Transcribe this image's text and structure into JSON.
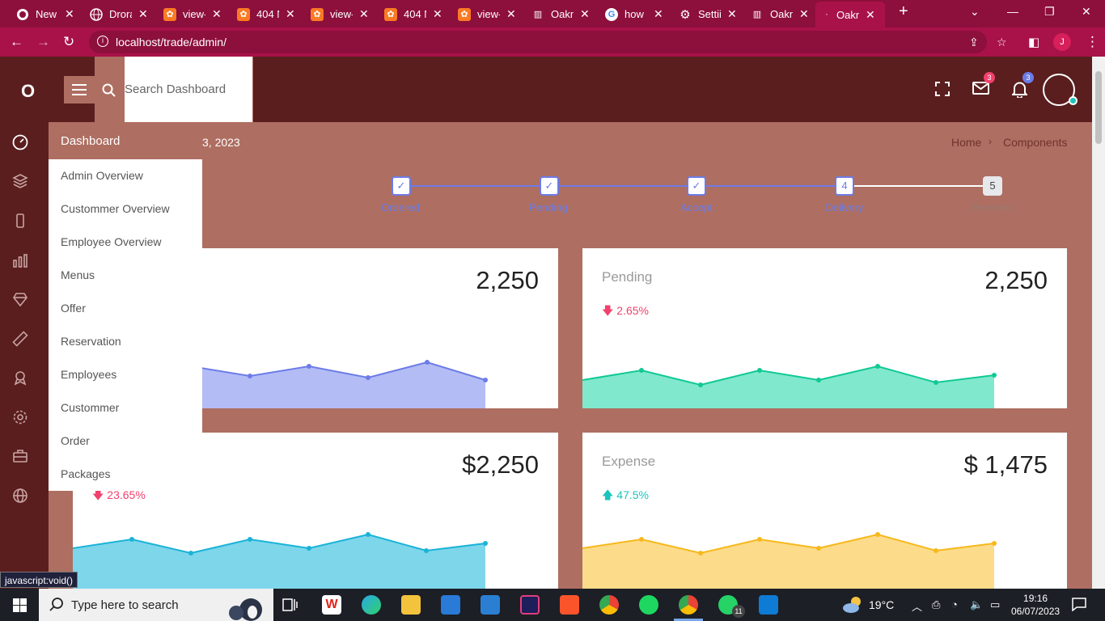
{
  "browser": {
    "tabs": [
      {
        "title": "New",
        "icon": "github-icon"
      },
      {
        "title": "Drora",
        "icon": "globe-icon"
      },
      {
        "title": "view-",
        "icon": "xampp-icon"
      },
      {
        "title": "404 N",
        "icon": "xampp-icon"
      },
      {
        "title": "view-",
        "icon": "xampp-icon"
      },
      {
        "title": "404 N",
        "icon": "xampp-icon"
      },
      {
        "title": "view-",
        "icon": "xampp-icon"
      },
      {
        "title": "Oakn",
        "icon": "barcode-icon"
      },
      {
        "title": "how",
        "icon": "google-icon"
      },
      {
        "title": "Settii",
        "icon": "gear-icon"
      },
      {
        "title": "Oakn",
        "icon": "barcode-icon"
      },
      {
        "title": "Oakn",
        "icon": "page-icon"
      }
    ],
    "url": "localhost/trade/admin/",
    "profile_initial": "J"
  },
  "header": {
    "logo": "O",
    "search_placeholder": "Search Dashboard",
    "mail_count": "3",
    "notification_count": "3"
  },
  "sidebar": {
    "icons": [
      "dashboard-icon",
      "layers-icon",
      "mobile-icon",
      "bar-chart-icon",
      "diamond-icon",
      "ruler-icon",
      "award-icon",
      "settings-icon",
      "briefcase-icon",
      "globe-icon"
    ]
  },
  "submenu": {
    "heading": "Dashboard",
    "items": [
      "Admin Overview",
      "Custommer Overview",
      "Employee Overview",
      "Menus",
      "Offer",
      "Reservation",
      "Employees",
      "Custommer",
      "Order",
      "Packages"
    ]
  },
  "page": {
    "date_fragment": "3, 2023",
    "breadcrumb": [
      "Home",
      "Components"
    ]
  },
  "steps": [
    {
      "marker": "✓",
      "label": "Ordered",
      "done": true
    },
    {
      "marker": "✓",
      "label": "Pending",
      "done": true
    },
    {
      "marker": "✓",
      "label": "Accept",
      "done": true
    },
    {
      "marker": "4",
      "label": "Delivery",
      "done": false,
      "current": true
    },
    {
      "marker": "5",
      "label": "Received",
      "done": false
    }
  ],
  "cards": [
    {
      "title": "",
      "value": "2,250",
      "change": "",
      "color": "#6c7ce7",
      "fill": "#b3bcf5"
    },
    {
      "title": "Pending",
      "value": "2,250",
      "change": "2.65%",
      "change_dir": "down",
      "color": "#10c994",
      "fill": "#80e8cd"
    },
    {
      "title": "",
      "value": "$2,250",
      "change": "23.65%",
      "change_dir": "down",
      "color": "#1ab3d8",
      "fill": "#7ed6ea"
    },
    {
      "title": "Expense",
      "value": "$ 1,475",
      "change": "47.5%",
      "change_dir": "up",
      "color": "#f6b81c",
      "fill": "#fcdc8a"
    }
  ],
  "status_tip": "javascript:void()",
  "taskbar": {
    "search_placeholder": "Type here to search",
    "weather": "19°C",
    "time": "19:16",
    "date": "06/07/2023",
    "whatsapp_badge": "11"
  },
  "colors": {
    "accent_blue": "#6c7ce7",
    "down": "#f1416c",
    "up": "#1bc5bd",
    "header": "#5a1e1e",
    "content_bg": "#ae6e61"
  }
}
